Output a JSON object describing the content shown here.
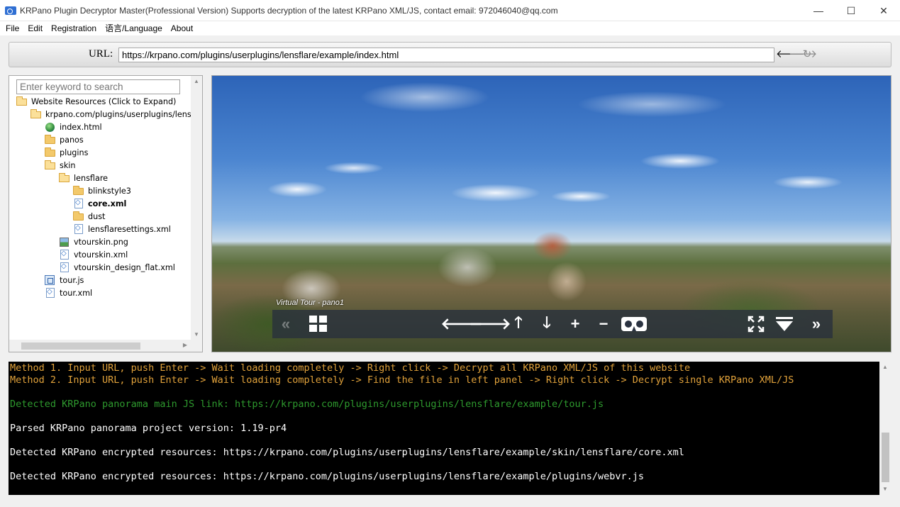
{
  "window": {
    "title": "KRPano Plugin Decryptor Master(Professional Version) Supports decryption of the latest KRPano XML/JS, contact email: 972046040@qq.com",
    "minimize_glyph": "—",
    "maximize_glyph": "☐",
    "close_glyph": "✕"
  },
  "menu": {
    "items": [
      "File",
      "Edit",
      "Registration",
      "语言/Language",
      "About"
    ]
  },
  "url_bar": {
    "label": "URL:",
    "value": "https://krpano.com/plugins/userplugins/lensflare/example/index.html",
    "back_glyph": "🡐",
    "forward_glyph": "🡒",
    "refresh_glyph": "↻"
  },
  "tree": {
    "search_placeholder": "Enter keyword to search",
    "items": [
      {
        "label": "Website Resources (Click to Expand)",
        "icon": "folder-open-icon",
        "bold": false
      },
      {
        "label": "krpano.com/plugins/userplugins/lens",
        "icon": "folder-open-icon",
        "bold": false
      },
      {
        "label": "index.html",
        "icon": "html-file-icon",
        "bold": false
      },
      {
        "label": "panos",
        "icon": "folder-icon",
        "bold": false
      },
      {
        "label": "plugins",
        "icon": "folder-icon",
        "bold": false
      },
      {
        "label": "skin",
        "icon": "folder-open-icon",
        "bold": false
      },
      {
        "label": "lensflare",
        "icon": "folder-open-icon",
        "bold": false
      },
      {
        "label": "blinkstyle3",
        "icon": "folder-icon",
        "bold": false
      },
      {
        "label": "core.xml",
        "icon": "xml-file-icon",
        "bold": true
      },
      {
        "label": "dust",
        "icon": "folder-icon",
        "bold": false
      },
      {
        "label": "lensflaresettings.xml",
        "icon": "xml-file-icon",
        "bold": false
      },
      {
        "label": "vtourskin.png",
        "icon": "image-file-icon",
        "bold": false
      },
      {
        "label": "vtourskin.xml",
        "icon": "xml-file-icon",
        "bold": false
      },
      {
        "label": "vtourskin_design_flat.xml",
        "icon": "xml-file-icon",
        "bold": false
      },
      {
        "label": "tour.js",
        "icon": "js-file-icon",
        "bold": false
      },
      {
        "label": "tour.xml",
        "icon": "xml-file-icon",
        "bold": false
      }
    ]
  },
  "viewer": {
    "tour_label": "Virtual Tour - pano1"
  },
  "console": {
    "lines": [
      {
        "text": "Method 1. Input URL, push Enter -> Wait loading completely -> Right click -> Decrypt all KRPano XML/JS of this website",
        "color": "#e0a13a"
      },
      {
        "text": "Method 2. Input URL, push Enter -> Wait loading completely -> Find the file in left panel -> Right click -> Decrypt single KRPano XML/JS",
        "color": "#e0a13a"
      },
      {
        "text": "Detected KRPano panorama main JS link: https://krpano.com/plugins/userplugins/lensflare/example/tour.js",
        "color": "#2e9a2e"
      },
      {
        "text": "Parsed KRPano panorama project version: 1.19-pr4",
        "color": "#ffffff"
      },
      {
        "text": "Detected KRPano encrypted resources: https://krpano.com/plugins/userplugins/lensflare/example/skin/lensflare/core.xml",
        "color": "#ffffff"
      },
      {
        "text": "Detected KRPano encrypted resources: https://krpano.com/plugins/userplugins/lensflare/example/plugins/webvr.js",
        "color": "#ffffff"
      }
    ]
  }
}
